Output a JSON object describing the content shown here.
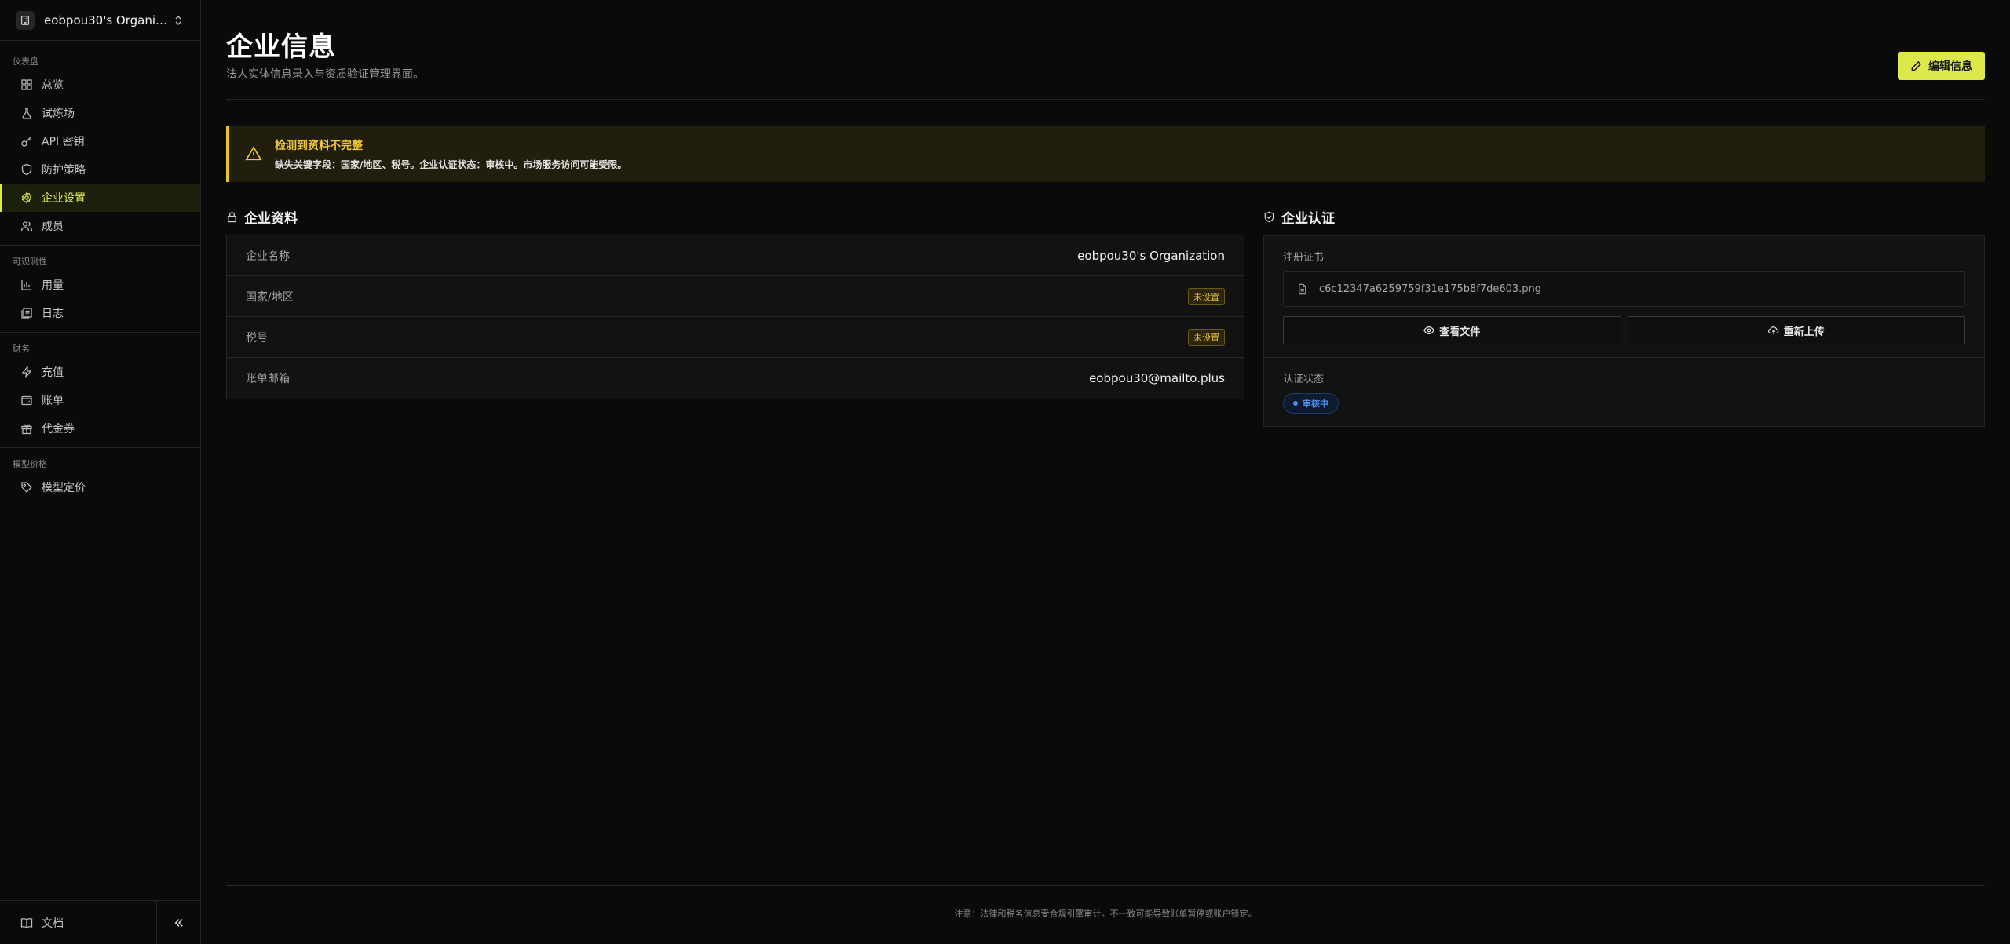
{
  "sidebar": {
    "org_name": "eobpou30's Organizati...",
    "groups": [
      {
        "title": "仪表盘",
        "items": [
          {
            "label": "总览",
            "icon": "grid-icon"
          },
          {
            "label": "试炼场",
            "icon": "flask-icon"
          },
          {
            "label": "API 密钥",
            "icon": "key-icon"
          },
          {
            "label": "防护策略",
            "icon": "shield-icon"
          },
          {
            "label": "企业设置",
            "icon": "gear-icon",
            "active": true
          },
          {
            "label": "成员",
            "icon": "users-icon"
          }
        ]
      },
      {
        "title": "可观测性",
        "items": [
          {
            "label": "用量",
            "icon": "bar-chart-icon"
          },
          {
            "label": "日志",
            "icon": "log-icon"
          }
        ]
      },
      {
        "title": "财务",
        "items": [
          {
            "label": "充值",
            "icon": "lightning-icon"
          },
          {
            "label": "账单",
            "icon": "wallet-icon"
          },
          {
            "label": "代金券",
            "icon": "gift-icon"
          }
        ]
      },
      {
        "title": "模型价格",
        "items": [
          {
            "label": "模型定价",
            "icon": "tag-icon"
          }
        ]
      }
    ],
    "docs_label": "文档"
  },
  "header": {
    "title": "企业信息",
    "subtitle": "法人实体信息录入与资质验证管理界面。",
    "edit_label": "编辑信息"
  },
  "alert": {
    "title": "检测到资料不完整",
    "text": "缺失关键字段：国家/地区、税号。企业认证状态：审核中。市场服务访问可能受限。"
  },
  "profile": {
    "title": "企业资料",
    "rows": [
      {
        "label": "企业名称",
        "value": "eobpou30's Organization"
      },
      {
        "label": "国家/地区",
        "badge": "未设置"
      },
      {
        "label": "税号",
        "badge": "未设置"
      },
      {
        "label": "账单邮箱",
        "value": "eobpou30@mailto.plus"
      }
    ]
  },
  "cert": {
    "title": "企业认证",
    "cert_label": "注册证书",
    "file_name": "c6c12347a6259759f31e175b8f7de603.png",
    "view_label": "查看文件",
    "reupload_label": "重新上传",
    "status_label": "认证状态",
    "status_value": "审核中"
  },
  "footer": {
    "text": "注意：法律和税务信息受合规引擎审计。不一致可能导致账单暂停或账户锁定。"
  },
  "colors": {
    "accent": "#dde84a",
    "warning": "#e8c52a",
    "info": "#4b8ef0"
  }
}
